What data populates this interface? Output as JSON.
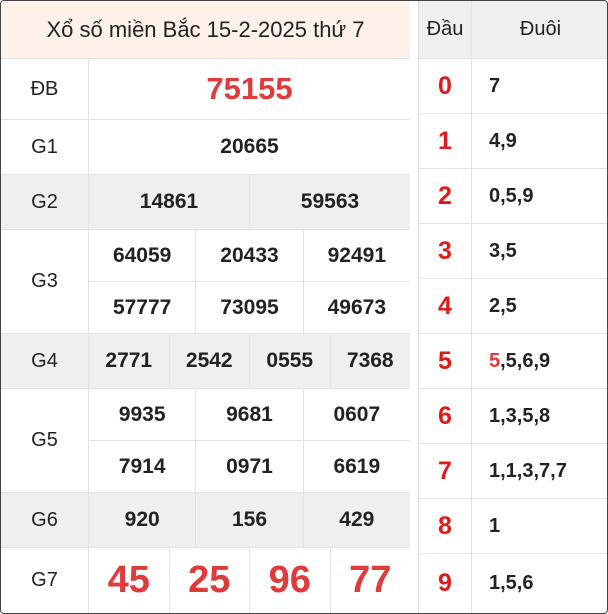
{
  "title": "Xổ số miền Bắc 15-2-2025 thứ 7",
  "prizes": [
    {
      "label": "ĐB",
      "numbers": [
        "75155"
      ]
    },
    {
      "label": "G1",
      "numbers": [
        "20665"
      ]
    },
    {
      "label": "G2",
      "numbers": [
        "14861",
        "59563"
      ]
    },
    {
      "label": "G3",
      "numbers": [
        "64059",
        "20433",
        "92491",
        "57777",
        "73095",
        "49673"
      ]
    },
    {
      "label": "G4",
      "numbers": [
        "2771",
        "2542",
        "0555",
        "7368"
      ]
    },
    {
      "label": "G5",
      "numbers": [
        "9935",
        "9681",
        "0607",
        "7914",
        "0971",
        "6619"
      ]
    },
    {
      "label": "G6",
      "numbers": [
        "920",
        "156",
        "429"
      ]
    },
    {
      "label": "G7",
      "numbers": [
        "45",
        "25",
        "96",
        "77"
      ]
    }
  ],
  "loto": {
    "head_label": "Đầu",
    "tail_label": "Đuôi",
    "rows": [
      {
        "head": "0",
        "tail_hl": "",
        "tail": "7"
      },
      {
        "head": "1",
        "tail_hl": "",
        "tail": "4,9"
      },
      {
        "head": "2",
        "tail_hl": "",
        "tail": "0,5,9"
      },
      {
        "head": "3",
        "tail_hl": "",
        "tail": "3,5"
      },
      {
        "head": "4",
        "tail_hl": "",
        "tail": "2,5"
      },
      {
        "head": "5",
        "tail_hl": "5",
        "tail": ",5,6,9"
      },
      {
        "head": "6",
        "tail_hl": "",
        "tail": "1,3,5,8"
      },
      {
        "head": "7",
        "tail_hl": "",
        "tail": "1,1,3,7,7"
      },
      {
        "head": "8",
        "tail_hl": "",
        "tail": "1"
      },
      {
        "head": "9",
        "tail_hl": "",
        "tail": "1,5,6"
      }
    ]
  },
  "colors": {
    "accent_red": "#e03b3b",
    "title_bg": "#fdf1e9",
    "grey_row": "#efefef"
  }
}
